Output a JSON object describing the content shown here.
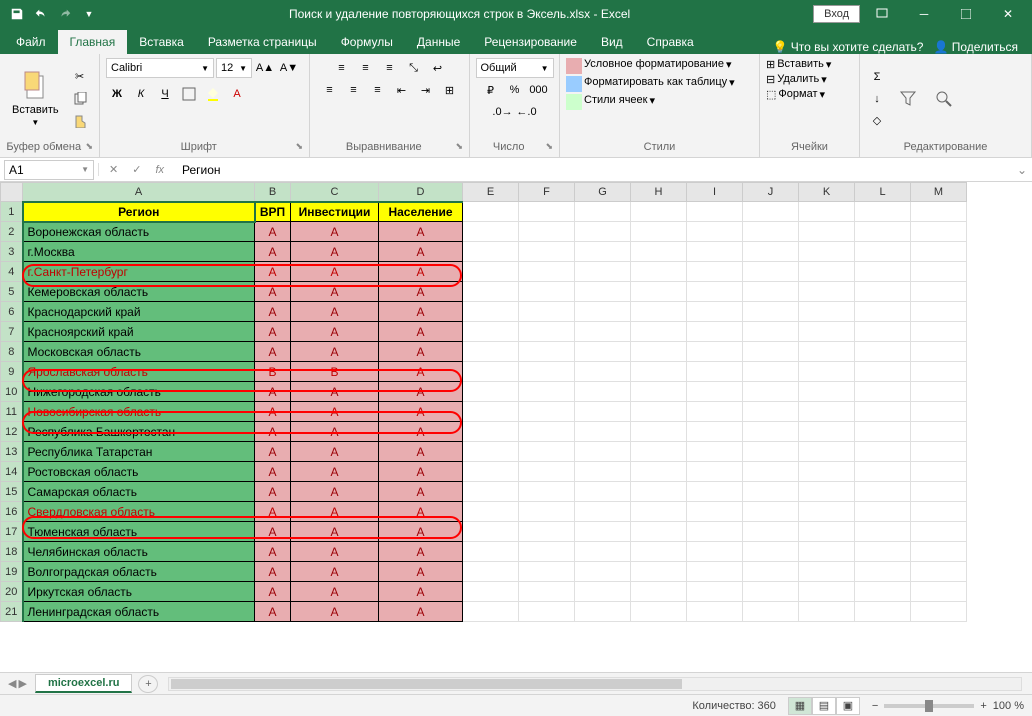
{
  "app": {
    "title": "Поиск и удаление повторяющихся строк в Эксель.xlsx  -  Excel",
    "login": "Вход"
  },
  "tabs": [
    "Файл",
    "Главная",
    "Вставка",
    "Разметка страницы",
    "Формулы",
    "Данные",
    "Рецензирование",
    "Вид",
    "Справка"
  ],
  "tabs_active_index": 1,
  "tell_me": "Что вы хотите сделать?",
  "share": "Поделиться",
  "ribbon": {
    "clipboard": {
      "paste": "Вставить",
      "label": "Буфер обмена"
    },
    "font": {
      "name": "Calibri",
      "size": "12",
      "label": "Шрифт",
      "bold": "Ж",
      "italic": "К",
      "underline": "Ч"
    },
    "alignment": {
      "label": "Выравнивание"
    },
    "number": {
      "format": "Общий",
      "label": "Число"
    },
    "styles": {
      "cond_fmt": "Условное форматирование",
      "fmt_table": "Форматировать как таблицу",
      "cell_styles": "Стили ячеек",
      "label": "Стили"
    },
    "cells": {
      "insert": "Вставить",
      "delete": "Удалить",
      "format": "Формат",
      "label": "Ячейки"
    },
    "editing": {
      "label": "Редактирование"
    }
  },
  "formula_bar": {
    "name_box": "A1",
    "formula": "Регион"
  },
  "columns": [
    "A",
    "B",
    "C",
    "D",
    "E",
    "F",
    "G",
    "H",
    "I",
    "J",
    "K",
    "L",
    "M"
  ],
  "selected_cols": [
    "A",
    "B",
    "C",
    "D"
  ],
  "headers": [
    "Регион",
    "ВРП",
    "Инвестиции",
    "Население"
  ],
  "rows": [
    {
      "n": 2,
      "region": "Воронежская область",
      "b": "A",
      "c": "A",
      "d": "A",
      "hl": false
    },
    {
      "n": 3,
      "region": "г.Москва",
      "b": "A",
      "c": "A",
      "d": "A",
      "hl": false
    },
    {
      "n": 4,
      "region": "г.Санкт-Петербург",
      "b": "A",
      "c": "A",
      "d": "A",
      "hl": true
    },
    {
      "n": 5,
      "region": "Кемеровская область",
      "b": "A",
      "c": "A",
      "d": "A",
      "hl": false
    },
    {
      "n": 6,
      "region": "Краснодарский край",
      "b": "A",
      "c": "A",
      "d": "A",
      "hl": false
    },
    {
      "n": 7,
      "region": "Красноярский край",
      "b": "A",
      "c": "A",
      "d": "A",
      "hl": false
    },
    {
      "n": 8,
      "region": "Московская область",
      "b": "A",
      "c": "A",
      "d": "A",
      "hl": false
    },
    {
      "n": 9,
      "region": "Ярославская область",
      "b": "B",
      "c": "B",
      "d": "A",
      "hl": true
    },
    {
      "n": 10,
      "region": "Нижегородская область",
      "b": "A",
      "c": "A",
      "d": "A",
      "hl": false
    },
    {
      "n": 11,
      "region": "Новосибирская область",
      "b": "A",
      "c": "A",
      "d": "A",
      "hl": true
    },
    {
      "n": 12,
      "region": "Республика Башкортостан",
      "b": "A",
      "c": "A",
      "d": "A",
      "hl": false
    },
    {
      "n": 13,
      "region": "Республика Татарстан",
      "b": "A",
      "c": "A",
      "d": "A",
      "hl": false
    },
    {
      "n": 14,
      "region": "Ростовская область",
      "b": "A",
      "c": "A",
      "d": "A",
      "hl": false
    },
    {
      "n": 15,
      "region": "Самарская область",
      "b": "A",
      "c": "A",
      "d": "A",
      "hl": false
    },
    {
      "n": 16,
      "region": "Свердловская область",
      "b": "A",
      "c": "A",
      "d": "A",
      "hl": true
    },
    {
      "n": 17,
      "region": "Тюменская область",
      "b": "A",
      "c": "A",
      "d": "A",
      "hl": false
    },
    {
      "n": 18,
      "region": "Челябинская область",
      "b": "A",
      "c": "A",
      "d": "A",
      "hl": false
    },
    {
      "n": 19,
      "region": "Волгоградская область",
      "b": "A",
      "c": "A",
      "d": "A",
      "hl": false
    },
    {
      "n": 20,
      "region": "Иркутская область",
      "b": "A",
      "c": "A",
      "d": "A",
      "hl": false
    },
    {
      "n": 21,
      "region": "Ленинградская область",
      "b": "A",
      "c": "A",
      "d": "A",
      "hl": false
    }
  ],
  "sheet_tab": "microexcel.ru",
  "statusbar": {
    "count_label": "Количество: 360",
    "zoom": "100 %"
  }
}
